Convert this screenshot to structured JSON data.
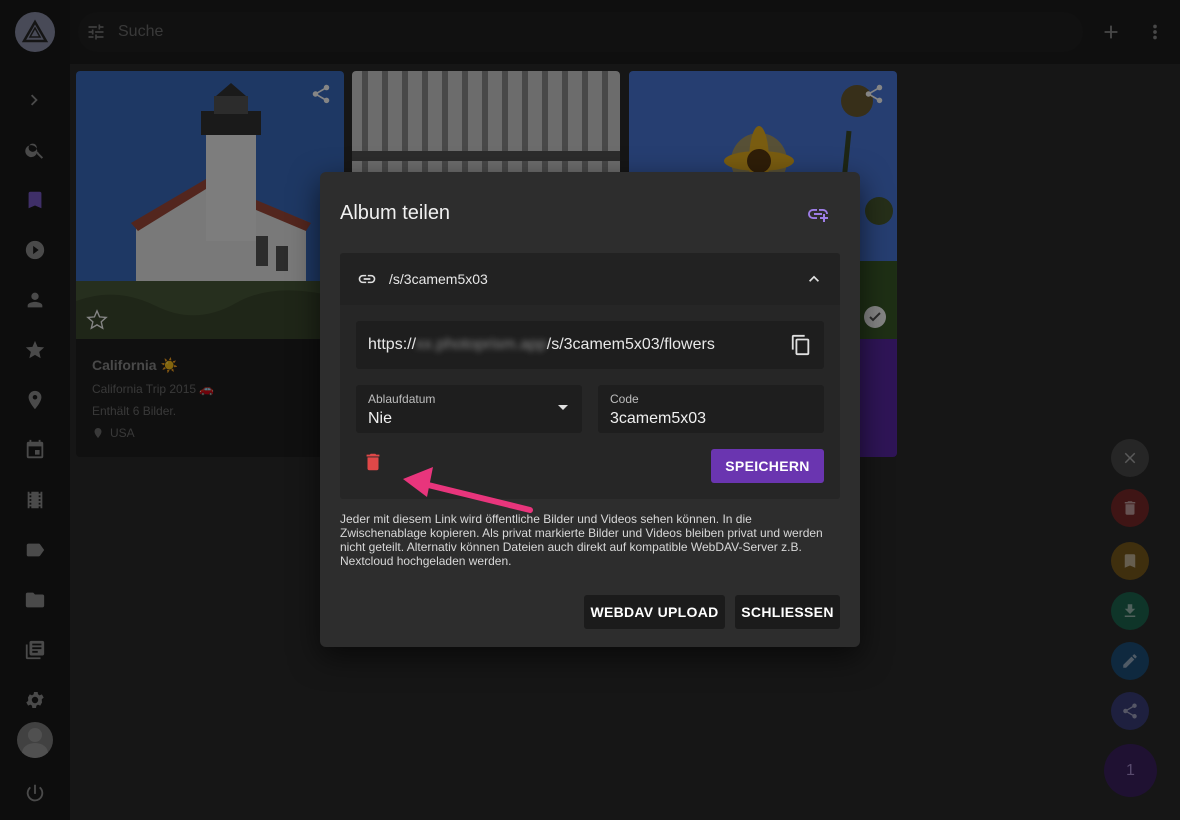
{
  "search": {
    "placeholder": "Suche"
  },
  "cards": [
    {
      "title": "California ☀️",
      "subtitle": "California Trip 2015 🚗",
      "count_text": "Enthält 6 Bilder.",
      "location": "USA"
    }
  ],
  "dialog": {
    "title": "Album teilen",
    "link_path": "/s/3camem5x03",
    "url_prefix": "https://",
    "url_blurred": "xx.photoprism.app",
    "url_suffix": "/s/3camem5x03/flowers",
    "expiry_label": "Ablaufdatum",
    "expiry_value": "Nie",
    "code_label": "Code",
    "code_value": "3camem5x03",
    "save_label": "SPEICHERN",
    "info_text": "Jeder mit diesem Link wird öffentliche Bilder und Videos sehen können. In die Zwischenablage kopieren. Als privat markierte Bilder und Videos bleiben privat und werden nicht geteilt. Alternativ können Dateien auch direkt auf kompatible WebDAV-Server z.B. Nextcloud hochgeladen werden.",
    "webdav_label": "WEBDAV UPLOAD",
    "close_label": "SCHLIESSEN"
  },
  "selection": {
    "count": "1"
  },
  "colors": {
    "accent": "#6a35b0",
    "danger": "#e04848",
    "annotation_arrow": "#e8357c"
  },
  "fab_colors": {
    "close": "#4a4a4a",
    "delete": "#7a2a2a",
    "bookmark": "#7a5a1c",
    "download": "#1e6650",
    "edit": "#1e4f7a",
    "share": "#3a3f7a"
  }
}
